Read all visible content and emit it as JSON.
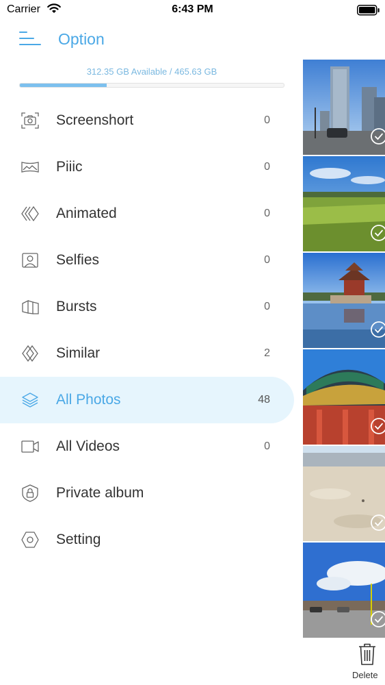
{
  "status_bar": {
    "carrier": "Carrier",
    "time": "6:43 PM"
  },
  "header": {
    "title": "Option",
    "menu_icon": "hamburger-menu-icon"
  },
  "storage": {
    "text": "312.35 GB Available / 465.63 GB",
    "used_fraction": 0.33,
    "fill_color": "#7cc0ee"
  },
  "menu": [
    {
      "label": "Screenshort",
      "count": "0",
      "icon": "screenshot-icon"
    },
    {
      "label": "Piiic",
      "count": "0",
      "icon": "panorama-icon"
    },
    {
      "label": "Animated",
      "count": "0",
      "icon": "animated-icon"
    },
    {
      "label": "Selfies",
      "count": "0",
      "icon": "selfie-icon"
    },
    {
      "label": "Bursts",
      "count": "0",
      "icon": "bursts-icon"
    },
    {
      "label": "Similar",
      "count": "2",
      "icon": "similar-icon"
    },
    {
      "label": "All Photos",
      "count": "48",
      "icon": "layers-icon",
      "active": true
    },
    {
      "label": "All Videos",
      "count": "0",
      "icon": "video-icon"
    },
    {
      "label": "Private album",
      "count": "",
      "icon": "lock-icon"
    },
    {
      "label": "Setting",
      "count": "",
      "icon": "settings-icon"
    }
  ],
  "photos": [
    {
      "subject": "city-skyscrapers",
      "selected": true
    },
    {
      "subject": "green-field",
      "selected": true
    },
    {
      "subject": "palace-tower-reflection",
      "selected": true
    },
    {
      "subject": "temple-roof",
      "selected": true
    },
    {
      "subject": "sandy-beach",
      "selected": true
    },
    {
      "subject": "sky-parking-lot",
      "selected": true
    }
  ],
  "delete": {
    "label": "Delete",
    "icon": "trash-icon"
  },
  "colors": {
    "accent": "#4aa8e6",
    "active_bg": "#e6f5fd"
  }
}
